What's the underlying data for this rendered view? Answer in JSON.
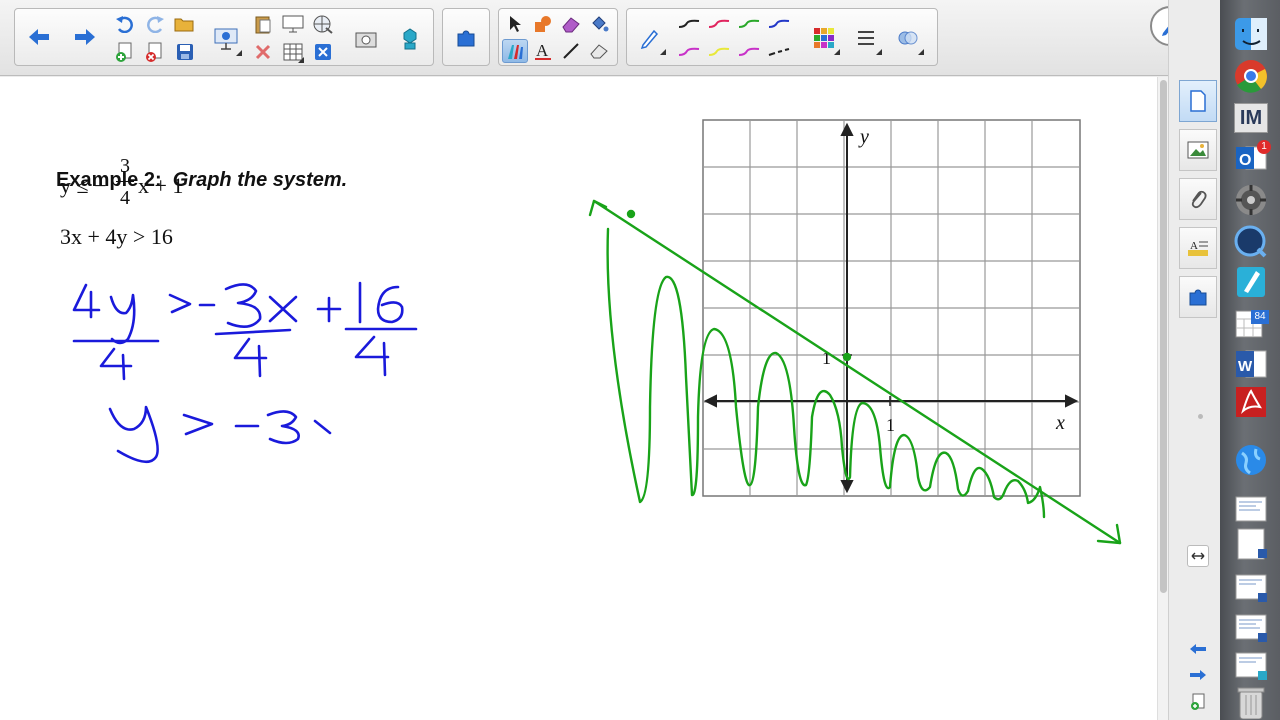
{
  "document": {
    "example_label": "Example 2:",
    "example_instruction": "Graph the system.",
    "inequality1": {
      "lhs": "y ≤ −",
      "numerator": "3",
      "denominator": "4",
      "rhs": "x + 1"
    },
    "inequality2": "3x + 4y > 16",
    "graph": {
      "x_axis_label": "x",
      "y_axis_label": "y",
      "x_tick_label": "1",
      "y_tick_label": "1"
    }
  },
  "handwriting": {
    "ink_blue": "#1a1adb",
    "ink_green": "#19a319",
    "step1": "4y > −3x + 16 (each term divided by 4)",
    "step2": "y > −3"
  },
  "toolbar": {
    "pen_colors": [
      "#222222",
      "#e0245e",
      "#2aa82a",
      "#2338c8",
      "#c832c8",
      "#e8e83a",
      "#c832c8",
      "#222222"
    ]
  },
  "side_tabs": [
    "page-sorter",
    "gallery",
    "attachments",
    "properties",
    "add-ons"
  ],
  "dock": {
    "items": [
      "finder",
      "chrome",
      "im",
      "outlook",
      "system-preferences",
      "quicktime",
      "smart-notebook",
      "calendar",
      "word",
      "acrobat",
      "network",
      "document-1",
      "document-2",
      "document-3",
      "document-4",
      "document-5",
      "trash"
    ],
    "im_label": "IM",
    "outlook_badge": "1",
    "calendar_badge": "84"
  }
}
